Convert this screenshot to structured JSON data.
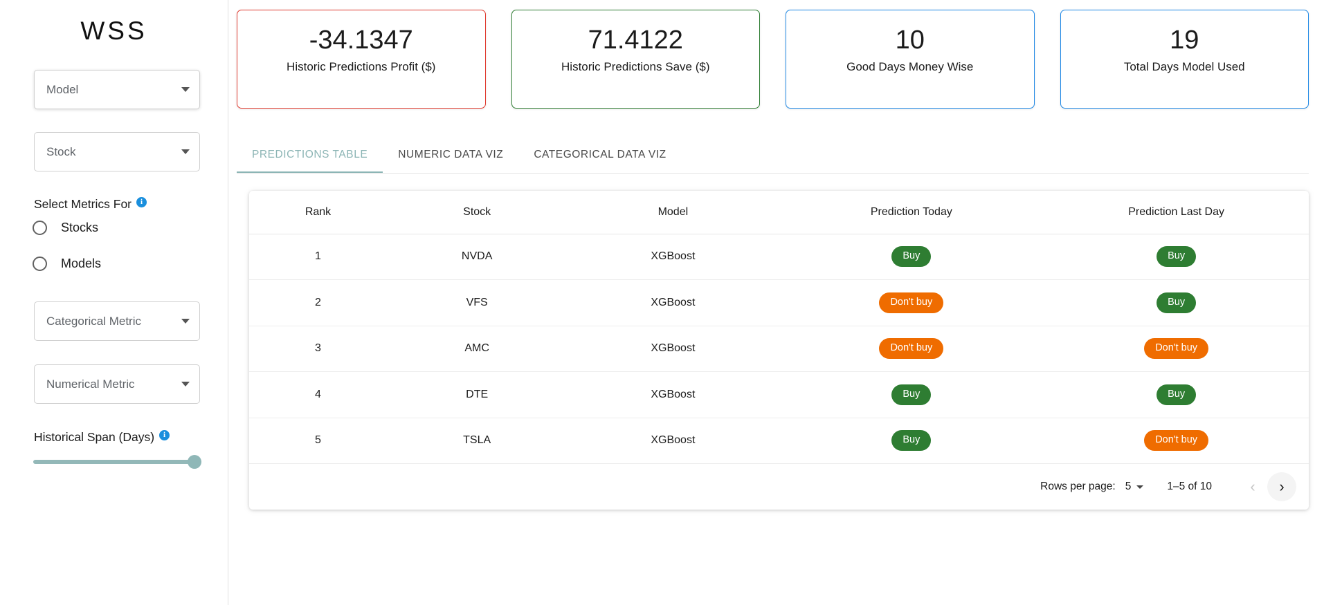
{
  "sidebar": {
    "brand": "WSS",
    "model_select": {
      "label": "Model",
      "icon": "chevron-down-icon"
    },
    "stock_select": {
      "label": "Stock",
      "icon": "chevron-down-icon"
    },
    "metrics_for_label": "Select Metrics For",
    "metrics_for_info": "i",
    "radios": [
      {
        "label": "Stocks",
        "selected": false
      },
      {
        "label": "Models",
        "selected": false
      }
    ],
    "categorical_metric_select": {
      "label": "Categorical Metric"
    },
    "numerical_metric_select": {
      "label": "Numerical Metric"
    },
    "historical_span_label": "Historical Span (Days)",
    "historical_span_info": "i",
    "slider": {
      "percent": 100,
      "track_color": "#93b8b8",
      "thumb_color": "#8fb7b7"
    }
  },
  "stat_cards": [
    {
      "value": "-34.1347",
      "caption": "Historic Predictions Profit ($)",
      "accent": "#e03a2f",
      "variant": "red"
    },
    {
      "value": "71.4122",
      "caption": "Historic Predictions Save ($)",
      "accent": "#2e7d32",
      "variant": "green"
    },
    {
      "value": "10",
      "caption": "Good Days Money Wise",
      "accent": "#1e88e5",
      "variant": "blue"
    },
    {
      "value": "19",
      "caption": "Total Days Model Used",
      "accent": "#1e88e5",
      "variant": "blue"
    }
  ],
  "tabs": [
    {
      "label": "Predictions Table",
      "active": true
    },
    {
      "label": "Numeric Data Viz",
      "active": false
    },
    {
      "label": "Categorical Data Viz",
      "active": false
    }
  ],
  "tab_active_color": "#8cb5b5",
  "table": {
    "headers": [
      "Rank",
      "Stock",
      "Model",
      "Prediction Today",
      "Prediction Last Day"
    ],
    "rows": [
      {
        "rank": "1",
        "stock": "NVDA",
        "model": "XGBoost",
        "today": "Buy",
        "today_kind": "buy",
        "last": "Buy",
        "last_kind": "buy"
      },
      {
        "rank": "2",
        "stock": "VFS",
        "model": "XGBoost",
        "today": "Don't buy",
        "today_kind": "dont",
        "last": "Buy",
        "last_kind": "buy"
      },
      {
        "rank": "3",
        "stock": "AMC",
        "model": "XGBoost",
        "today": "Don't buy",
        "today_kind": "dont",
        "last": "Don't buy",
        "last_kind": "dont"
      },
      {
        "rank": "4",
        "stock": "DTE",
        "model": "XGBoost",
        "today": "Buy",
        "today_kind": "buy",
        "last": "Buy",
        "last_kind": "buy"
      },
      {
        "rank": "5",
        "stock": "TSLA",
        "model": "XGBoost",
        "today": "Buy",
        "today_kind": "buy",
        "last": "Don't buy",
        "last_kind": "dont"
      }
    ],
    "badge_colors": {
      "buy": "#2e7d32",
      "dont": "#ef6c00"
    }
  },
  "pagination": {
    "rows_per_page_label": "Rows per page:",
    "rows_per_page_value": "5",
    "range_text": "1–5 of 10",
    "prev_icon": "chevron-left-icon",
    "next_icon": "chevron-right-icon"
  }
}
